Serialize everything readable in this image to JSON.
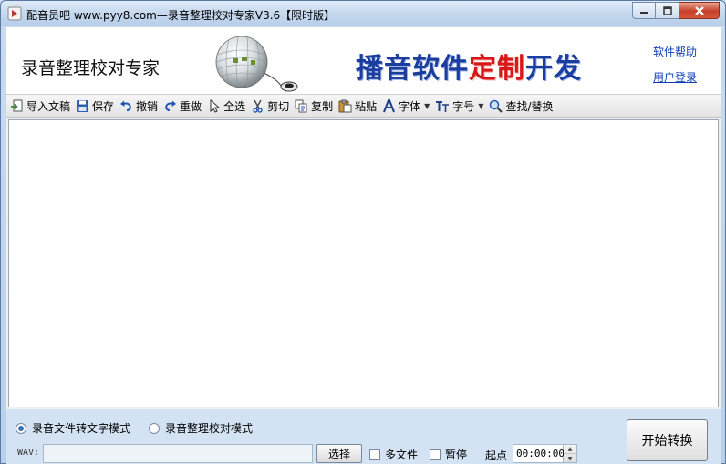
{
  "window": {
    "title": "配音员吧 www.pyy8.com—录音整理校对专家V3.6【限时版】"
  },
  "header": {
    "app_name": "录音整理校对专家",
    "banner_part1": "播音软件",
    "banner_part2": "定制",
    "banner_part3": "开发",
    "help_link": "软件帮助",
    "login_link": "用户登录"
  },
  "toolbar": {
    "items": [
      {
        "label": "导入文稿",
        "icon": "import-icon"
      },
      {
        "label": "保存",
        "icon": "save-icon"
      },
      {
        "label": "撤销",
        "icon": "undo-icon"
      },
      {
        "label": "重做",
        "icon": "redo-icon"
      },
      {
        "label": "全选",
        "icon": "select-all-icon"
      },
      {
        "label": "剪切",
        "icon": "cut-icon"
      },
      {
        "label": "复制",
        "icon": "copy-icon"
      },
      {
        "label": "粘贴",
        "icon": "paste-icon"
      },
      {
        "label": "字体",
        "icon": "font-icon"
      },
      {
        "label": "字号",
        "icon": "font-size-icon"
      },
      {
        "label": "查找/替换",
        "icon": "find-replace-icon"
      }
    ]
  },
  "editor": {
    "content": ""
  },
  "bottom": {
    "mode_audio_to_text": "录音文件转文字模式",
    "mode_proofread": "录音整理校对模式",
    "selected_mode": "录音文件转文字模式",
    "wav_label": "WAV:",
    "wav_value": "",
    "select_button": "选择",
    "multi_file": "多文件",
    "pause": "暂停",
    "start_label": "起点",
    "start_time": "00:00:00",
    "convert_button": "开始转换"
  },
  "colors": {
    "link": "#0b3fb5",
    "banner_blue": "#1b3d9e",
    "banner_red": "#d81818",
    "close_button": "#c7402a"
  }
}
